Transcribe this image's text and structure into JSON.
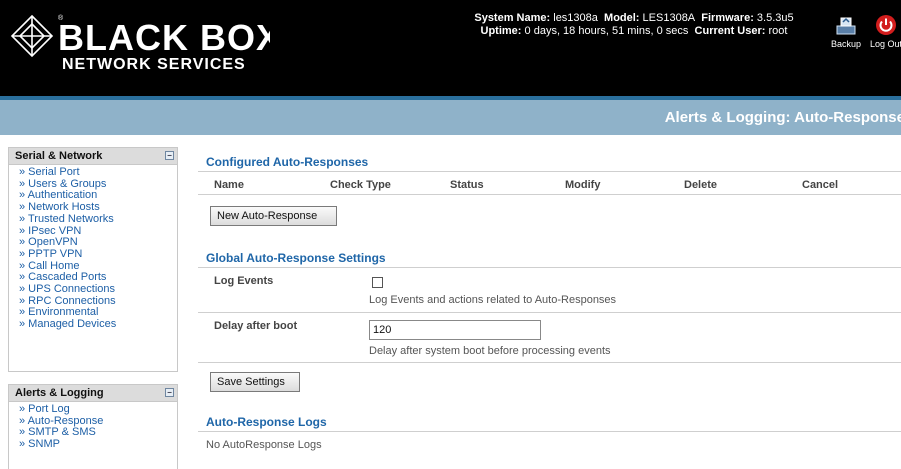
{
  "header": {
    "system_name_label": "System Name:",
    "system_name": "les1308a",
    "model_label": "Model:",
    "model": "LES1308A",
    "firmware_label": "Firmware:",
    "firmware": "3.5.3u5",
    "uptime_label": "Uptime:",
    "uptime": "0 days, 18 hours, 51 mins, 0 secs",
    "current_user_label": "Current User:",
    "current_user": "root",
    "backup_label": "Backup",
    "logout_label": "Log Out"
  },
  "logo": {
    "line1": "BLACK BOX",
    "line2": "NETWORK SERVICES",
    "reg": "®"
  },
  "page_title": "Alerts & Logging: Auto-Response",
  "sidebar": {
    "serial_network": {
      "title": "Serial & Network",
      "collapse_symbol": "−",
      "items": [
        "» Serial Port",
        "» Users & Groups",
        "» Authentication",
        "» Network Hosts",
        "» Trusted Networks",
        "» IPsec VPN",
        "» OpenVPN",
        "» PPTP VPN",
        "» Call Home",
        "» Cascaded Ports",
        "» UPS Connections",
        "» RPC Connections",
        "» Environmental",
        "» Managed Devices"
      ]
    },
    "alerts_logging": {
      "title": "Alerts & Logging",
      "collapse_symbol": "−",
      "items": [
        "» Port Log",
        "» Auto-Response",
        "» SMTP & SMS",
        "» SNMP"
      ]
    }
  },
  "configured": {
    "title": "Configured Auto-Responses",
    "columns": [
      "Name",
      "Check Type",
      "Status",
      "Modify",
      "Delete",
      "Cancel"
    ],
    "new_button": "New Auto-Response"
  },
  "global": {
    "title": "Global Auto-Response Settings",
    "log_events_label": "Log Events",
    "log_events_checked": false,
    "log_events_desc": "Log Events and actions related to Auto-Responses",
    "delay_label": "Delay after boot",
    "delay_value": "120",
    "delay_desc": "Delay after system boot before processing events",
    "save_button": "Save Settings"
  },
  "logs": {
    "title": "Auto-Response Logs",
    "empty_text": "No AutoResponse Logs"
  },
  "colors": {
    "header_bg": "#000000",
    "title_bar": "#8fb2c9",
    "accent_line": "#2a6f9c",
    "section_title": "#1f66a8",
    "link": "#1d5fa6"
  }
}
